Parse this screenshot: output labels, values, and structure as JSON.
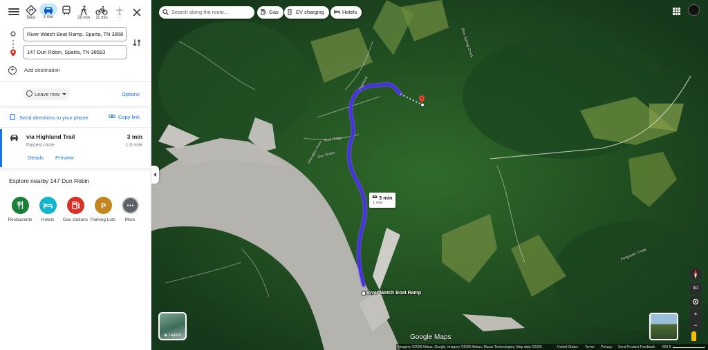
{
  "sidebar": {
    "modes": [
      {
        "name": "best",
        "label": "Best"
      },
      {
        "name": "driving",
        "label": "3 min"
      },
      {
        "name": "transit",
        "label": ""
      },
      {
        "name": "walking",
        "label": "26 min"
      },
      {
        "name": "cycling",
        "label": "11 min"
      },
      {
        "name": "flights",
        "label": "—"
      }
    ],
    "origin_value": "River Watch Boat Ramp, Sparta, TN 3858",
    "destination_value": "147 Dun Robin, Sparta, TN 38583",
    "add_destination": "Add destination",
    "leave_now": "Leave now",
    "options": "Options",
    "send_directions": "Send directions to your phone",
    "copy_link": "Copy link",
    "route": {
      "via": "via Highland Trail",
      "subtitle": "Fastest route",
      "time": "3 min",
      "distance": "1.0 mile",
      "details": "Details",
      "preview": "Preview"
    },
    "explore_title": "Explore nearby 147 Dun Robin",
    "categories": [
      {
        "label": "Restaurants",
        "color": "#188038",
        "icon": "fork-knife-icon"
      },
      {
        "label": "Hotels",
        "color": "#12b5cb",
        "icon": "bed-icon"
      },
      {
        "label": "Gas stations",
        "color": "#d93025",
        "icon": "gas-pump-icon"
      },
      {
        "label": "Parking Lots",
        "color": "#c5851f",
        "icon": "parking-icon"
      },
      {
        "label": "More",
        "color": "#5f6368",
        "icon": "more-icon"
      }
    ]
  },
  "map": {
    "search_placeholder": "Search along the route...",
    "chips": [
      "Gas",
      "EV charging",
      "Hotels"
    ],
    "route_box": {
      "time": "3 min",
      "distance": "1 mile"
    },
    "origin_label": "River Watch Boat Ramp",
    "labels": {
      "blue_spring_creek": "Blue Spring Creek",
      "ferguson_creek": "Ferguson Creek",
      "skye_ridge": "Skye Ridge",
      "glenalpin_point": "Glenalpin Point",
      "dun_robin": "Dun Robin",
      "highland": "Highland"
    },
    "layers_label": "Layers",
    "control_3d": "3D",
    "logo": "Google Maps",
    "attribution": "Imagery ©2026 Airbus, Google, Imagery ©2026 Airbus, Maxar Technologies, Map data ©2026",
    "footer_links": [
      "United States",
      "Terms",
      "Privacy",
      "Send Product Feedback"
    ],
    "scale": "500 ft",
    "route_color": "#4b2fe8"
  }
}
